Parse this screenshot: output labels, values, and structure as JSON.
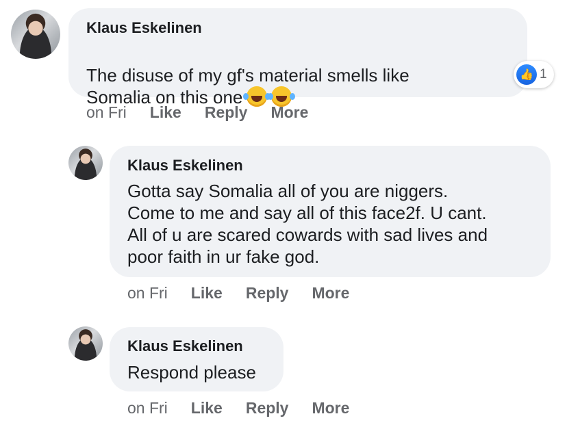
{
  "comments": [
    {
      "author": "Klaus Eskelinen",
      "text_line1": "The disuse of my gf's material smells like",
      "text_line2": "Somalia on this one",
      "emojis": [
        "laughing-crying-emoji",
        "laughing-crying-emoji"
      ],
      "reaction": {
        "icon": "like-icon",
        "count": "1"
      },
      "time": "on Fri",
      "actions": [
        "Like",
        "Reply",
        "More"
      ]
    },
    {
      "author": "Klaus Eskelinen",
      "text": "Gotta say Somalia all of you are niggers.\nCome to me and say all of this face2f. U cant.\nAll of u are scared cowards with sad lives and\npoor faith in ur fake god.",
      "time": "on Fri",
      "actions": [
        "Like",
        "Reply",
        "More"
      ]
    },
    {
      "author": "Klaus Eskelinen",
      "text": "Respond please",
      "time": "on Fri",
      "actions": [
        "Like",
        "Reply",
        "More"
      ]
    }
  ],
  "colors": {
    "bubble": "#f0f2f5",
    "secondary_text": "#65676b",
    "like_blue": "#1877f2"
  }
}
